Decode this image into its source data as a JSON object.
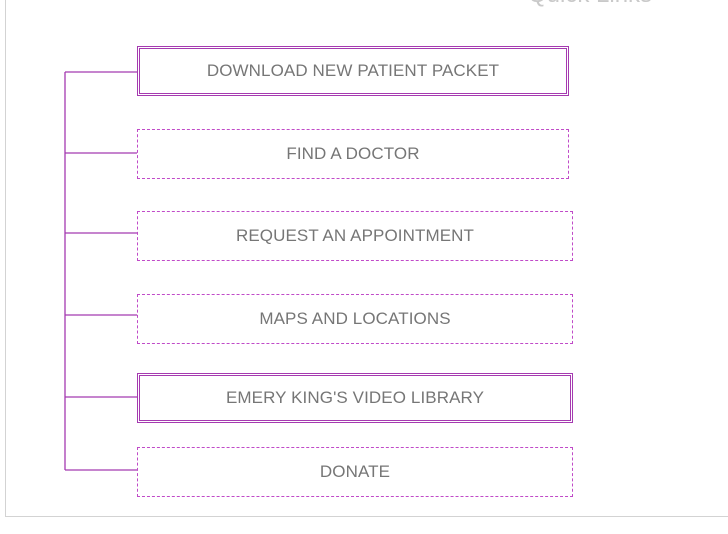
{
  "panel": {
    "title": "Quick Links"
  },
  "links": [
    {
      "label": "DOWNLOAD NEW PATIENT PACKET",
      "style": "featured"
    },
    {
      "label": "FIND A DOCTOR",
      "style": "plain"
    },
    {
      "label": "REQUEST AN APPOINTMENT",
      "style": "plain"
    },
    {
      "label": "MAPS AND LOCATIONS",
      "style": "plain"
    },
    {
      "label": "EMERY KING'S VIDEO LIBRARY",
      "style": "featured"
    },
    {
      "label": "DONATE",
      "style": "plain"
    }
  ],
  "colors": {
    "accent": "#a53ab0",
    "dashed": "#c04ac8",
    "text": "#767676",
    "panel_border": "#d3d3d3",
    "title": "#c9c9c9"
  }
}
